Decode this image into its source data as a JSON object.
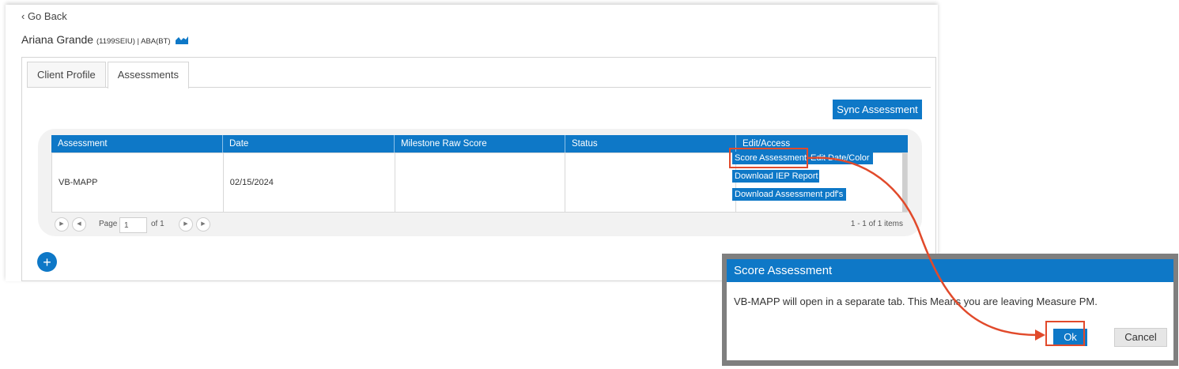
{
  "nav": {
    "go_back": "‹ Go Back"
  },
  "client": {
    "name": "Ariana Grande",
    "meta": "(1199SEIU) | ABA(BT)"
  },
  "tabs": [
    {
      "label": "Client Profile",
      "active": false
    },
    {
      "label": "Assessments",
      "active": true
    }
  ],
  "toolbar": {
    "sync_label": "Sync Assessment"
  },
  "grid": {
    "columns": [
      "Assessment",
      "Date",
      "Milestone Raw Score",
      "Status",
      "Edit/Access"
    ],
    "rows": [
      {
        "assessment": "VB-MAPP",
        "date": "02/15/2024",
        "milestone_raw_score": "",
        "status": "",
        "actions": [
          "Score Assessment",
          "Edit Date/Color",
          "Download IEP Report",
          "Download Assessment pdf's"
        ]
      }
    ],
    "pager": {
      "page_label": "Page",
      "page_value": "1",
      "of_label": "of 1",
      "items_label": "1 - 1 of 1 items"
    }
  },
  "add_button": "+",
  "dialog": {
    "title": "Score Assessment",
    "message": "VB-MAPP will open in a separate tab. This Means you are leaving Measure PM.",
    "ok_label": "Ok",
    "cancel_label": "Cancel"
  },
  "colors": {
    "accent": "#0e78c7",
    "highlight": "#e14a2b"
  },
  "icons": [
    "chart-icon",
    "first-page-icon",
    "prev-page-icon",
    "next-page-icon",
    "last-page-icon",
    "plus-icon"
  ]
}
